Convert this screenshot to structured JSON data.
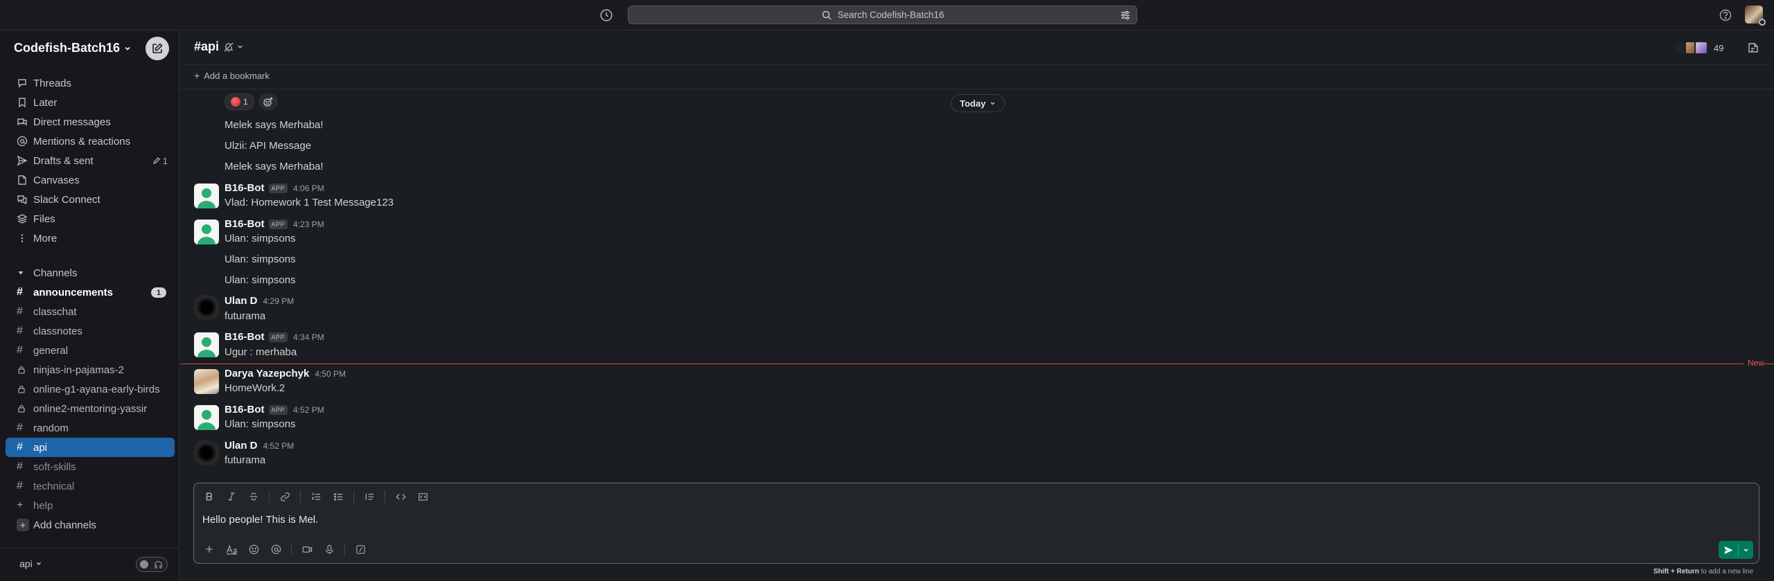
{
  "topbar": {
    "search_placeholder": "Search Codefish-Batch16",
    "icons": [
      "history-icon",
      "search-icon",
      "filter-icon",
      "help-icon"
    ]
  },
  "workspace": {
    "name": "Codefish-Batch16"
  },
  "sidebar": {
    "nav": [
      {
        "label": "Threads",
        "icon": "threads-icon"
      },
      {
        "label": "Later",
        "icon": "bookmark-icon"
      },
      {
        "label": "Direct messages",
        "icon": "dm-icon"
      },
      {
        "label": "Mentions & reactions",
        "icon": "at-icon"
      },
      {
        "label": "Drafts & sent",
        "icon": "send-icon",
        "count": "1"
      },
      {
        "label": "Canvases",
        "icon": "canvas-icon"
      },
      {
        "label": "Slack Connect",
        "icon": "connect-icon"
      },
      {
        "label": "Files",
        "icon": "files-icon"
      },
      {
        "label": "More",
        "icon": "more-icon"
      }
    ],
    "channels_heading": "Channels",
    "channels": [
      {
        "name": "announcements",
        "badge": "1"
      },
      {
        "name": "classchat"
      },
      {
        "name": "classnotes"
      },
      {
        "name": "general"
      },
      {
        "name": "ninjas-in-pajamas-2"
      },
      {
        "name": "online-g1-ayana-early-birds"
      },
      {
        "name": "online2-mentoring-yassir"
      },
      {
        "name": "random"
      },
      {
        "name": "api"
      },
      {
        "name": "soft-skills"
      },
      {
        "name": "technical"
      },
      {
        "name": "help"
      }
    ],
    "add_channels": "Add channels",
    "huddle_channel": "api"
  },
  "channel": {
    "name": "api",
    "member_count": "49",
    "bookmark_label": "Add a bookmark"
  },
  "messages": {
    "date_divider": "Today",
    "reaction_count": "1",
    "new_label": "New",
    "app_tag": "APP",
    "items": [
      {
        "text": "Melek says Merhaba!"
      },
      {
        "text": "Ulzii: API Message"
      },
      {
        "text": "Melek says Merhaba!"
      },
      {
        "author": "B16-Bot",
        "time": "4:06 PM",
        "text": "Vlad: Homework 1 Test Message123"
      },
      {
        "author": "B16-Bot",
        "time": "4:23 PM",
        "text": "Ulan: simpsons"
      },
      {
        "text": "Ulan: simpsons"
      },
      {
        "text": "Ulan: simpsons"
      },
      {
        "author": "Ulan D",
        "time": "4:29 PM",
        "text": "futurama"
      },
      {
        "author": "B16-Bot",
        "time": "4:34 PM",
        "text": "Ugur : merhaba"
      },
      {
        "author": "Darya Yazepchyk",
        "time": "4:50 PM",
        "text": "HomeWork.2"
      },
      {
        "author": "B16-Bot",
        "time": "4:52 PM",
        "text": "Ulan: simpsons"
      },
      {
        "author": "Ulan D",
        "time": "4:52 PM",
        "text": "futurama"
      }
    ]
  },
  "composer": {
    "value": "Hello people! This is Mel.",
    "hint_keys": "Shift + Return",
    "hint_text": " to add a new line"
  },
  "colors": {
    "accent": "#1d64a8",
    "send": "#007a5a",
    "new_divider": "#d94a3a"
  }
}
